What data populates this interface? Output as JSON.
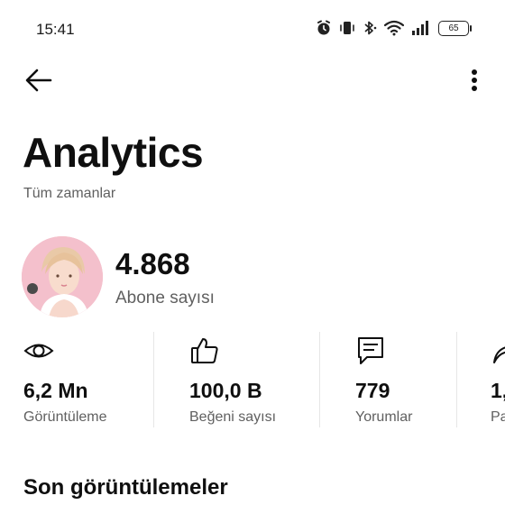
{
  "status_bar": {
    "time": "15:41",
    "battery": "65",
    "icons": [
      "alarm-icon",
      "vibrate-icon",
      "bluetooth-icon",
      "wifi-icon",
      "signal-icon",
      "battery-icon"
    ]
  },
  "header": {
    "back_icon": "arrow-left-icon",
    "more_icon": "more-vertical-icon"
  },
  "title": "Analytics",
  "subtitle": "Tüm zamanlar",
  "channel": {
    "subscriber_count": "4.868",
    "subscriber_label": "Abone sayısı"
  },
  "stats": [
    {
      "icon": "eye-icon",
      "value": "6,2 Mn",
      "label": "Görüntüleme"
    },
    {
      "icon": "thumbs-up-icon",
      "value": "100,0 B",
      "label": "Beğeni sayısı"
    },
    {
      "icon": "comment-icon",
      "value": "779",
      "label": "Yorumlar"
    },
    {
      "icon": "share-icon",
      "value": "1,",
      "label": "Pa"
    }
  ],
  "section": {
    "title": "Son görüntülemeler"
  },
  "colors": {
    "text_primary": "#0f0f0f",
    "text_secondary": "#606060",
    "divider": "#e6e6e6"
  }
}
